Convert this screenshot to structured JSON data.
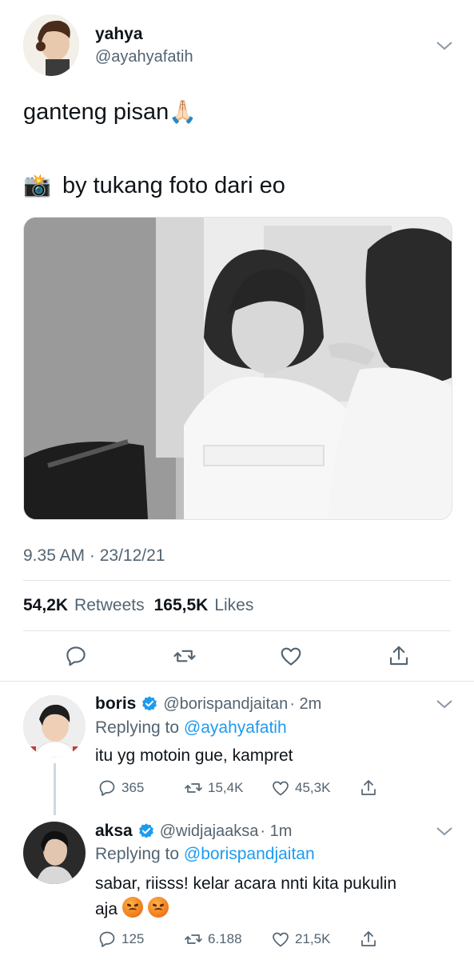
{
  "tweet": {
    "name": "yahya",
    "handle": "@ayahyafatih",
    "line1": "ganteng pisan",
    "line1_emoji": "🙏🏻",
    "line2_emoji": "📸",
    "line2": "by tukang foto dari eo",
    "timestamp": "9.35 AM · 23/12/21",
    "retweets_count": "54,2K",
    "retweets_label": "Retweets",
    "likes_count": "165,5K",
    "likes_label": "Likes"
  },
  "replies": [
    {
      "name": "boris",
      "handle": "@borispandjaitan",
      "time": "· 2m",
      "replying_prefix": "Replying to",
      "replying_to": "@ayahyafatih",
      "text": "itu yg motoin gue, kampret",
      "reply_count": "365",
      "retweet_count": "15,4K",
      "like_count": "45,3K"
    },
    {
      "name": "aksa",
      "handle": "@widjajaaksa",
      "time": "· 1m",
      "replying_prefix": "Replying to",
      "replying_to": "@borispandjaitan",
      "text_line1": "sabar, riisss! kelar acara nnti kita pukulin",
      "text_line2": "aja",
      "reply_count": "125",
      "retweet_count": "6.188",
      "like_count": "21,5K"
    }
  ],
  "icons": {
    "reply": "reply-icon",
    "retweet": "retweet-icon",
    "like": "heart-icon",
    "share": "share-icon",
    "more": "chevron-down-icon",
    "verified": "verified-badge-icon"
  },
  "colors": {
    "link": "#1d9bf0",
    "muted": "#536471",
    "text": "#0f1419",
    "verified": "#1d9bf0"
  }
}
